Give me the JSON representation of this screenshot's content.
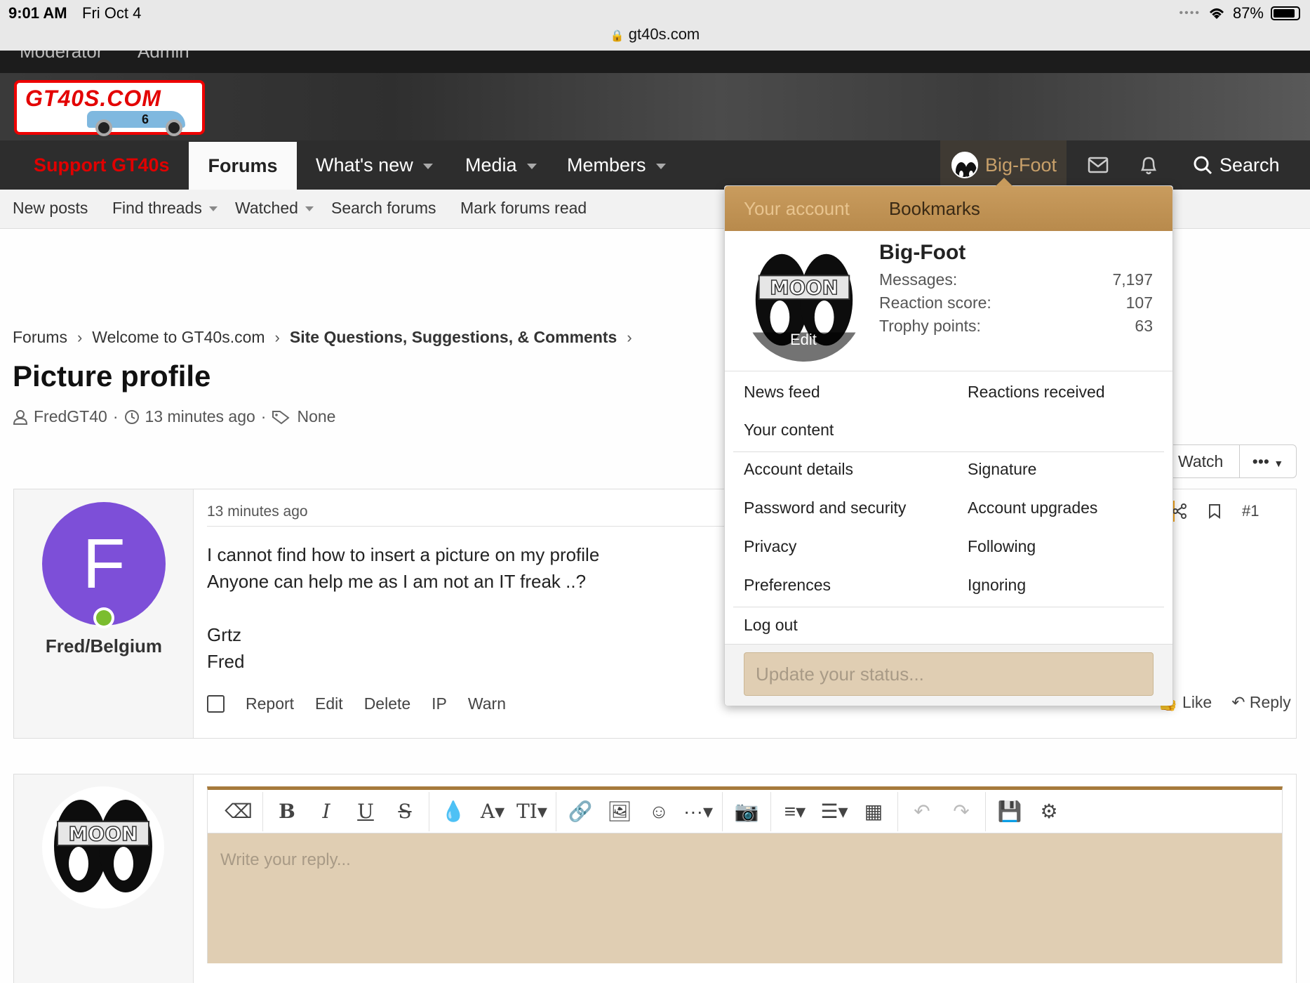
{
  "status_bar": {
    "time": "9:01 AM",
    "date": "Fri Oct 4",
    "battery": "87%",
    "battery_level": 0.87,
    "url": "gt40s.com"
  },
  "topbar": {
    "items": [
      "Moderator",
      "Admin"
    ]
  },
  "logo": {
    "text": "GT40S.COM",
    "car_number": "6"
  },
  "nav": {
    "support": "Support GT40s",
    "forums": "Forums",
    "whats_new": "What's new",
    "media": "Media",
    "members": "Members",
    "user": "Big-Foot",
    "search": "Search"
  },
  "subnav": {
    "new_posts": "New posts",
    "find_threads": "Find threads",
    "watched": "Watched",
    "search_forums": "Search forums",
    "mark_read": "Mark forums read"
  },
  "breadcrumb": {
    "items": [
      "Forums",
      "Welcome to GT40s.com",
      "Site Questions, Suggestions, & Comments"
    ]
  },
  "thread": {
    "title": "Picture profile",
    "author": "FredGT40",
    "time": "13 minutes ago",
    "tags": "None"
  },
  "thread_actions": {
    "watch": "Watch",
    "more": "•••"
  },
  "post": {
    "author": "Fred/Belgium",
    "avatar_letter": "F",
    "date": "13 minutes ago",
    "body": "I cannot find how to insert a picture on my profile\nAnyone can help me as I am not an IT freak ..?\n\nGrtz\nFred",
    "number": "#1",
    "actions": [
      "Report",
      "Edit",
      "Delete",
      "IP",
      "Warn"
    ],
    "like": "Like",
    "reply": "Reply"
  },
  "reply_editor": {
    "placeholder": "Write your reply..."
  },
  "account_menu": {
    "tab_account": "Your account",
    "tab_bookmarks": "Bookmarks",
    "username": "Big-Foot",
    "avatar_edit": "Edit",
    "avatar_text": "MOON",
    "stats": [
      {
        "label": "Messages:",
        "value": "7,197"
      },
      {
        "label": "Reaction score:",
        "value": "107"
      },
      {
        "label": "Trophy points:",
        "value": "63"
      }
    ],
    "links": {
      "news_feed": "News feed",
      "reactions_received": "Reactions received",
      "your_content": "Your content",
      "account_details": "Account details",
      "signature": "Signature",
      "password_security": "Password and security",
      "account_upgrades": "Account upgrades",
      "privacy": "Privacy",
      "following": "Following",
      "preferences": "Preferences",
      "ignoring": "Ignoring",
      "log_out": "Log out"
    },
    "status_placeholder": "Update your status..."
  },
  "colors": {
    "accent": "#b88a4c",
    "support_red": "#e00000",
    "avatar_purple": "#7d4fd8",
    "online_green": "#7bbd2f",
    "nav_bg": "#2d2d2d"
  }
}
